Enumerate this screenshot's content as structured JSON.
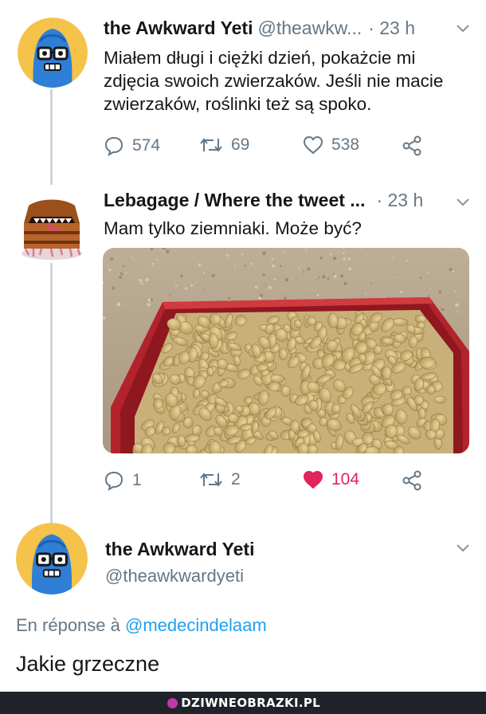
{
  "tweets": [
    {
      "name": "the Awkward Yeti",
      "handle": "@theawkw...",
      "time": "· 23 h",
      "text": "Miałem długi i ciężki dzień, pokażcie mi zdjęcia swoich zwierzaków. Jeśli nie macie zwierzaków, roślinki też są spoko.",
      "replies": "574",
      "retweets": "69",
      "likes": "538",
      "avatar_icon": "blue-yeti-avatar-icon"
    },
    {
      "name": "Lebagage / Where the tweet ...",
      "time": "· 23 h",
      "text": "Mam tylko ziemniaki. Może być?",
      "replies": "1",
      "retweets": "2",
      "likes": "104",
      "liked": true,
      "avatar_icon": "treasure-chest-mimic-avatar-icon",
      "media": "potatoes-in-red-crate-photo"
    }
  ],
  "main_tweet": {
    "name": "the Awkward Yeti",
    "handle": "@theawkwardyeti",
    "reply_prefix": "En réponse à",
    "reply_to": "@medecindelaam",
    "text": "Jakie grzeczne"
  },
  "footer": {
    "logo_text": "DZIWNEOBRAZKI.PL"
  },
  "colors": {
    "text": "#14171a",
    "secondary": "#657786",
    "link": "#1da1f2",
    "like_active": "#e0245e",
    "thread_line": "#ccd6dd",
    "yeti_blue": "#2f7fd6",
    "avatar_bg": "#f5c34a"
  }
}
